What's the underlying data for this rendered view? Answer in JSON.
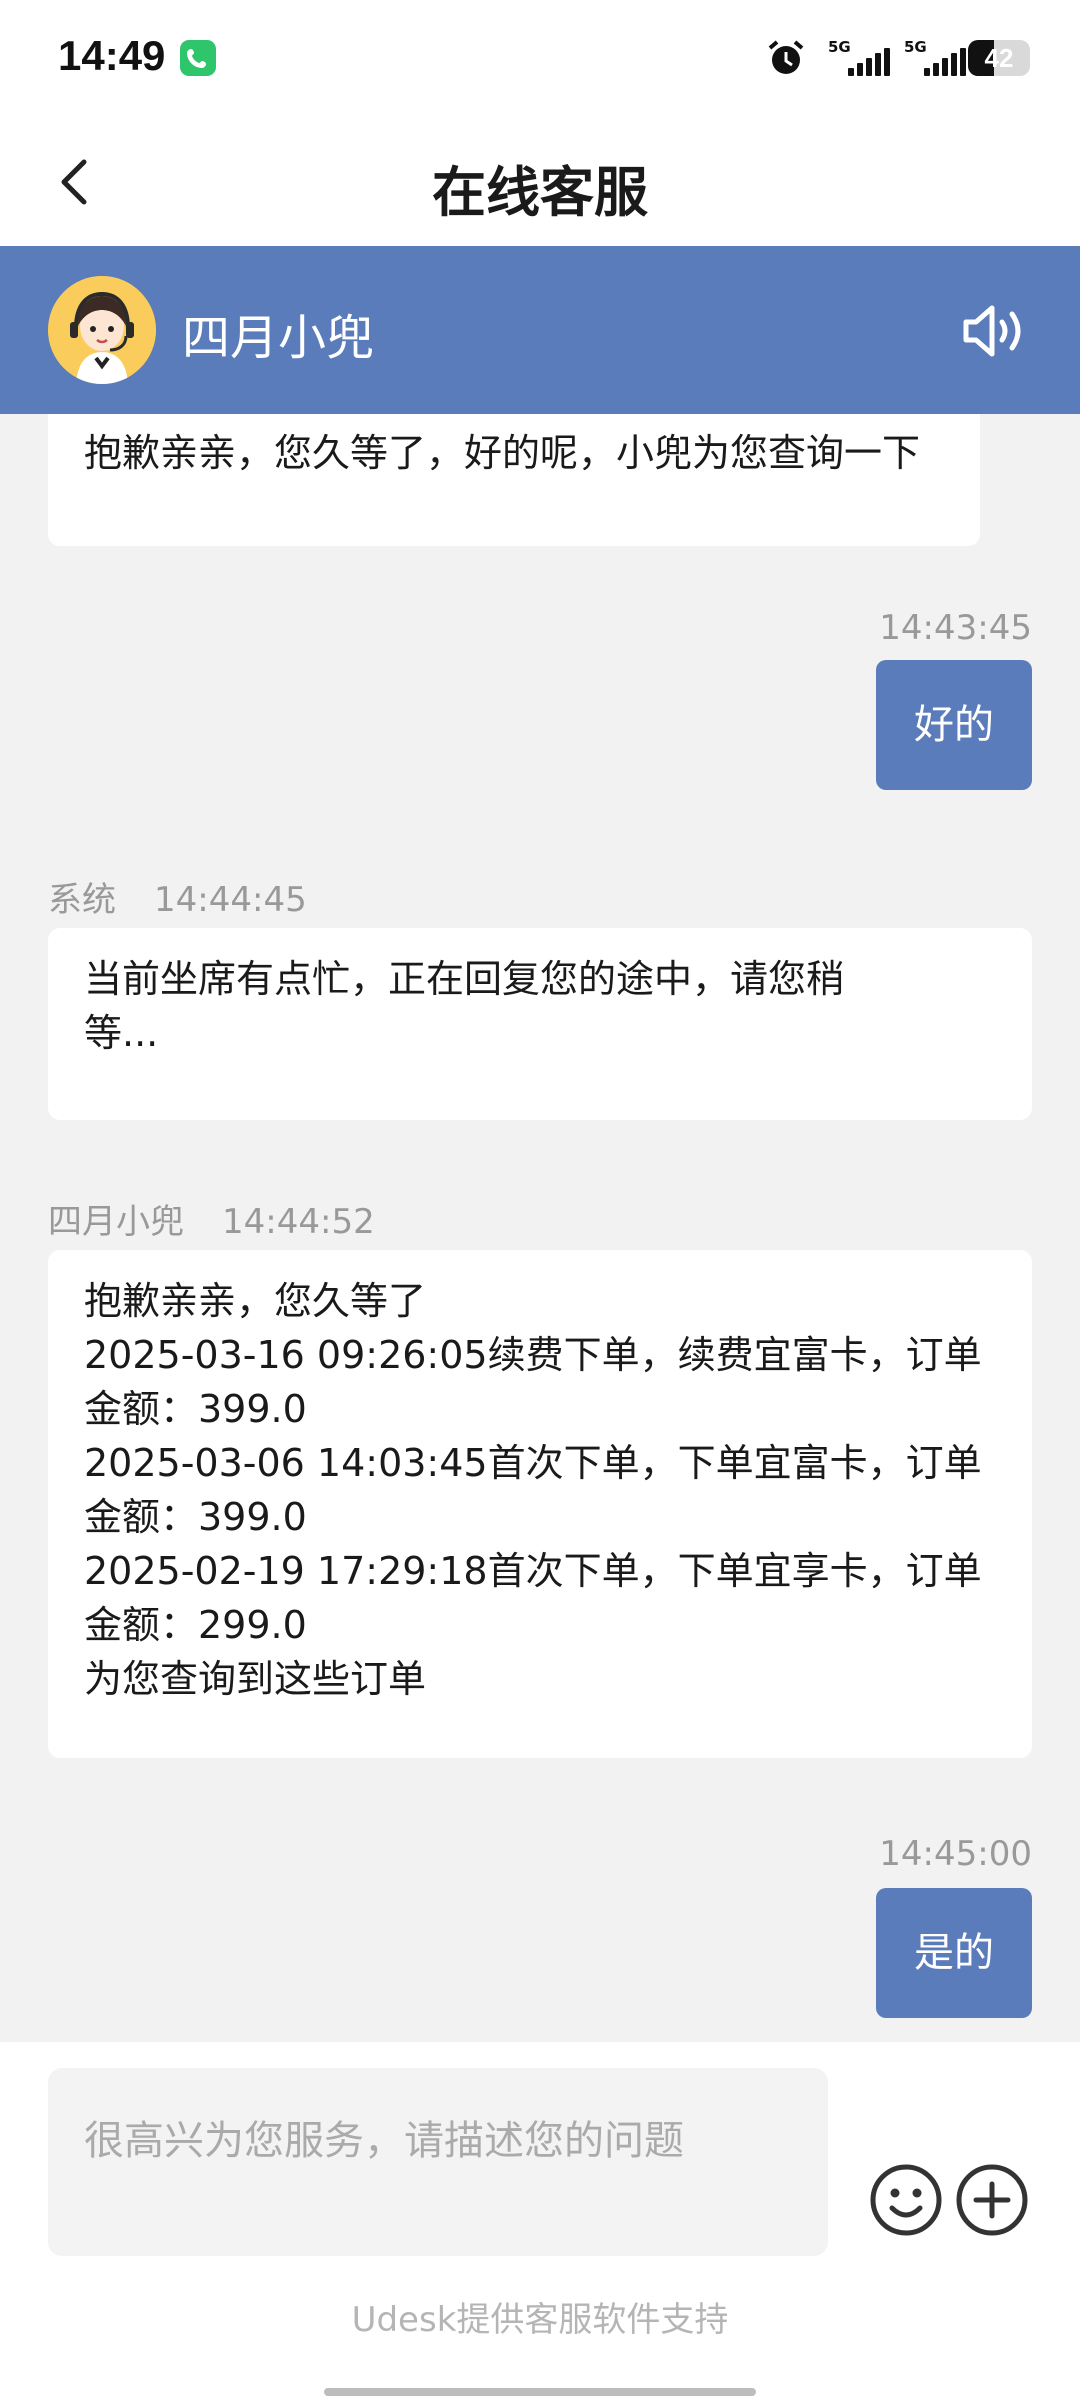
{
  "status_bar": {
    "time": "14:49",
    "signal1_label": "5G",
    "signal2_label": "5G",
    "battery": "42"
  },
  "nav": {
    "title": "在线客服"
  },
  "agent": {
    "name": "四月小兜"
  },
  "messages": {
    "m1": {
      "text": "抱歉亲亲，您久等了，好的呢，小兜为您查询一下"
    },
    "m2": {
      "time": "14:43:45",
      "text": "好的"
    },
    "m3": {
      "sender": "系统",
      "time": "14:44:45",
      "lines": [
        "当前坐席有点忙，正在回复您的途中，请您稍",
        "等..."
      ]
    },
    "m4": {
      "sender": "四月小兜",
      "time": "14:44:52",
      "lines": [
        "抱歉亲亲，您久等了",
        "2025-03-16 09:26:05续费下单，续费宜富卡，订单",
        "金额：399.0",
        "2025-03-06 14:03:45首次下单，下单宜富卡，订单",
        "金额：399.0",
        "2025-02-19 17:29:18首次下单，下单宜享卡，订单",
        "金额：299.0",
        "为您查询到这些订单"
      ]
    },
    "m5": {
      "time": "14:45:00",
      "text": "是的"
    }
  },
  "input": {
    "placeholder": "很高兴为您服务，请描述您的问题"
  },
  "footer": {
    "text": "Udesk提供客服软件支持"
  },
  "colors": {
    "accent": "#5b7cba",
    "background": "#f2f2f2",
    "call_badge": "#2fc66b"
  }
}
